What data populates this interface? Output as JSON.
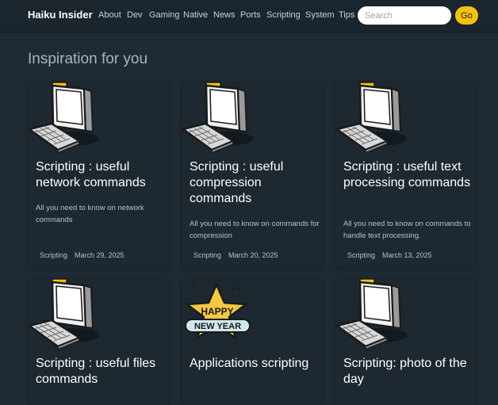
{
  "navbar": {
    "brand": "Haiku Insider",
    "links": [
      "About",
      "Dev",
      "Gaming",
      "Native",
      "News",
      "Ports",
      "Scripting",
      "System",
      "Tips"
    ],
    "search_placeholder": "Search",
    "go_label": "Go"
  },
  "section_title": "Inspiration for you",
  "cards": [
    {
      "icon": "computer-icon",
      "title": "Scripting : useful network commands",
      "description": "All you need to know on network commands",
      "category": "Scripting",
      "date": "March 29, 2025"
    },
    {
      "icon": "computer-icon",
      "title": "Scripting : useful compression commands",
      "description": "All you need to know on commands for compression",
      "category": "Scripting",
      "date": "March 20, 2025"
    },
    {
      "icon": "computer-icon",
      "title": "Scripting : useful text processing commands",
      "description": "All you need to know on commands to handle text processing.",
      "category": "Scripting",
      "date": "March 13, 2025"
    },
    {
      "icon": "computer-icon",
      "title": "Scripting : useful files commands"
    },
    {
      "icon": "happy-new-year-icon",
      "icon_text": [
        "HAPPY",
        "NEW YEAR"
      ],
      "title": "Applications scripting"
    },
    {
      "icon": "computer-icon",
      "title": "Scripting: photo of the day"
    }
  ],
  "colors": {
    "background": "#1f2a33",
    "accent": "#f4c20d",
    "navbar": "#1b252d"
  }
}
